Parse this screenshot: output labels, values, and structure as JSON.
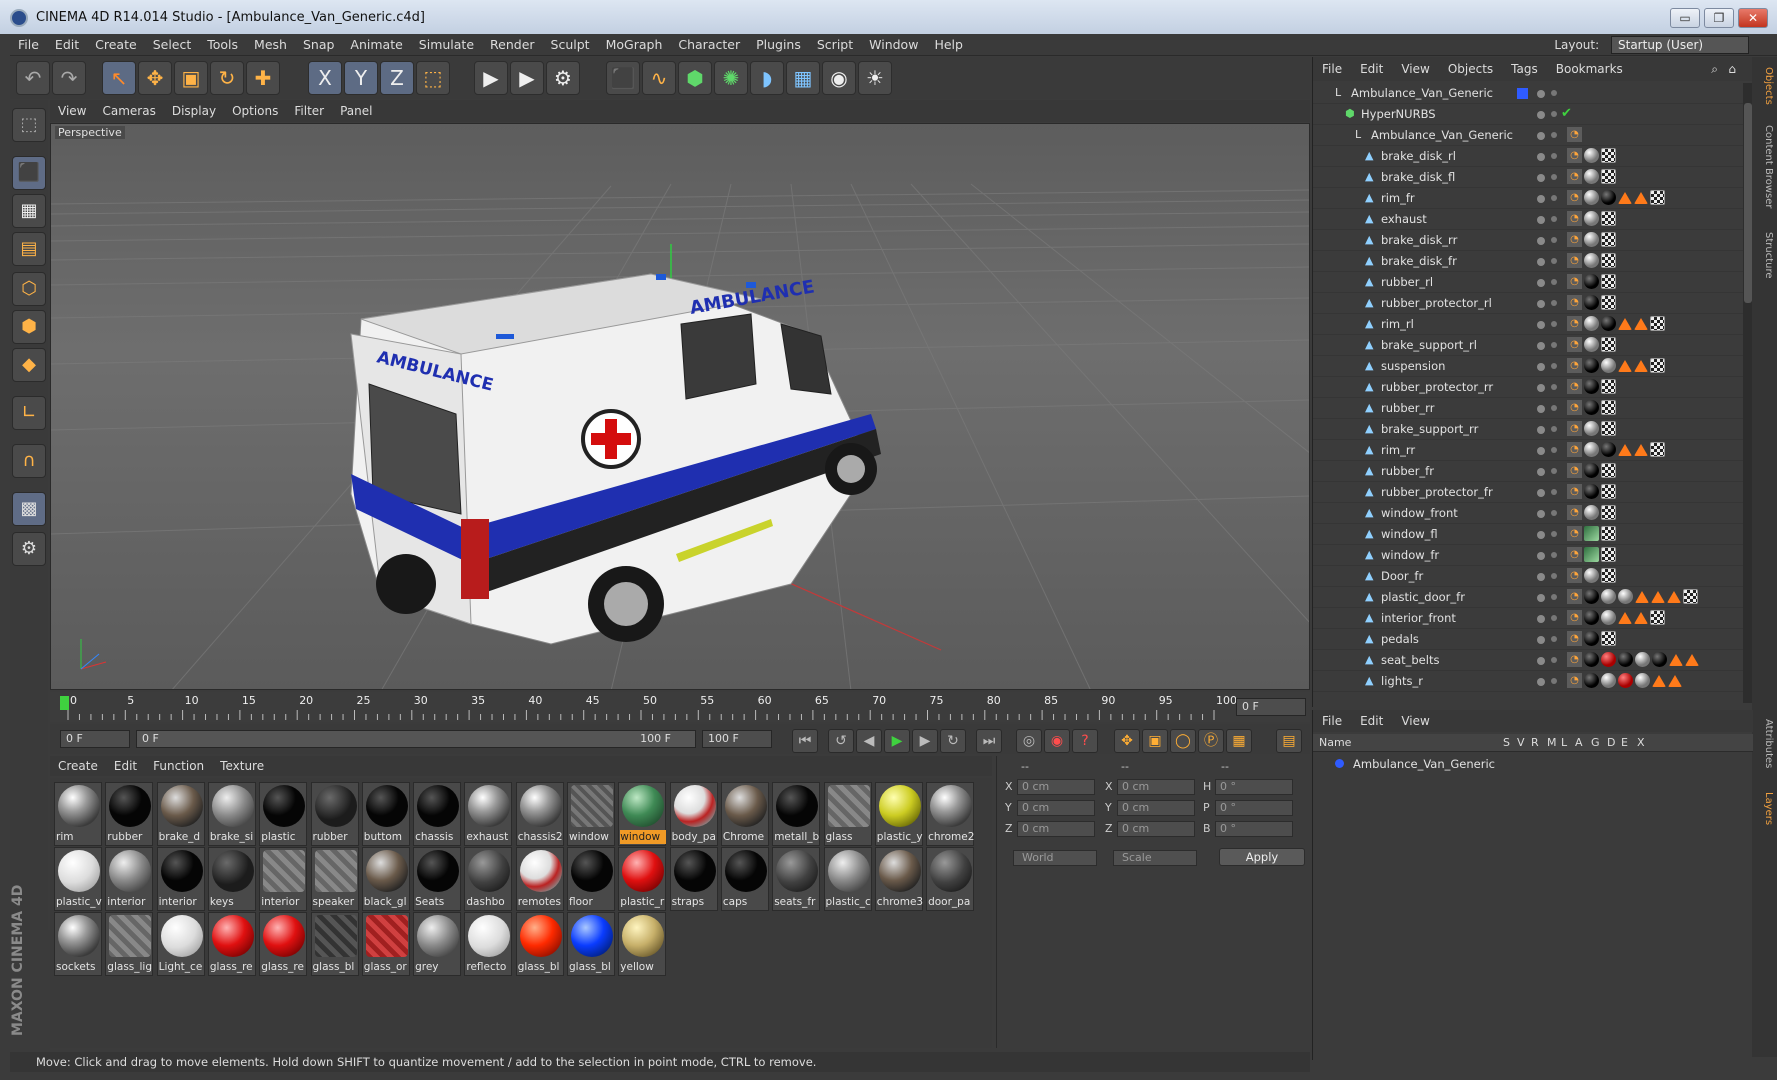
{
  "window": {
    "title": "CINEMA 4D R14.014 Studio - [Ambulance_Van_Generic.c4d]",
    "min": "▭",
    "max": "❐",
    "close": "✕"
  },
  "menu": [
    "File",
    "Edit",
    "Create",
    "Select",
    "Tools",
    "Mesh",
    "Snap",
    "Animate",
    "Simulate",
    "Render",
    "Sculpt",
    "MoGraph",
    "Character",
    "Plugins",
    "Script",
    "Window",
    "Help"
  ],
  "layout": {
    "label": "Layout:",
    "value": "Startup (User)"
  },
  "toolbar": {
    "undo": "↶",
    "redo": "↷",
    "select": "↖",
    "move": "✥",
    "scale": "▣",
    "rotate": "↻",
    "add": "✚",
    "x": "X",
    "y": "Y",
    "z": "Z",
    "coord": "⬚",
    "render_view": "▶",
    "render_pv": "▶",
    "render_settings": "⚙",
    "cube": "⬛",
    "spline": "∿",
    "nurbs": "⬢",
    "array": "✺",
    "deformer": "◗",
    "floor": "▦",
    "camera": "◉",
    "light": "☀"
  },
  "viewport": {
    "menu": [
      "View",
      "Cameras",
      "Display",
      "Options",
      "Filter",
      "Panel"
    ],
    "label": "Perspective",
    "vehicle_side_text": "AMBULANCE",
    "vehicle_rear_text": "AMBULANCE"
  },
  "timeline": {
    "ticks": [
      "0",
      "5",
      "10",
      "15",
      "20",
      "25",
      "30",
      "35",
      "40",
      "45",
      "50",
      "55",
      "60",
      "65",
      "70",
      "75",
      "80",
      "85",
      "90",
      "95",
      "100"
    ],
    "frame_display": "0 F"
  },
  "playback": {
    "start": "0 F",
    "range_start": "0 F",
    "range_end": "100 F",
    "end": "100 F"
  },
  "materials": {
    "menu": [
      "Create",
      "Edit",
      "Function",
      "Texture"
    ],
    "items": [
      {
        "label": "rim",
        "style": "chrome"
      },
      {
        "label": "rubber",
        "style": "black"
      },
      {
        "label": "brake_d",
        "style": "env"
      },
      {
        "label": "brake_si",
        "style": "grey"
      },
      {
        "label": "plastic",
        "style": "black"
      },
      {
        "label": "rubber",
        "style": "darkgrain"
      },
      {
        "label": "buttom",
        "style": "black"
      },
      {
        "label": "chassis",
        "style": "black"
      },
      {
        "label": "exhaust",
        "style": "chrome"
      },
      {
        "label": "chassis2",
        "style": "chrome"
      },
      {
        "label": "window",
        "style": "tex"
      },
      {
        "label": "window",
        "style": "green",
        "selected": true
      },
      {
        "label": "body_pa",
        "style": "body"
      },
      {
        "label": "Chrome",
        "style": "env"
      },
      {
        "label": "metall_b",
        "style": "black"
      },
      {
        "label": "glass",
        "style": "glass"
      },
      {
        "label": "plastic_y",
        "style": "yellow"
      },
      {
        "label": "chrome2",
        "style": "chrome"
      },
      {
        "label": "plastic_v",
        "style": "white"
      },
      {
        "label": "interior",
        "style": "grey"
      },
      {
        "label": "interior",
        "style": "black"
      },
      {
        "label": "keys",
        "style": "darkgrain"
      },
      {
        "label": "interior",
        "style": "glass"
      },
      {
        "label": "speaker",
        "style": "glass"
      },
      {
        "label": "black_gl",
        "style": "env"
      },
      {
        "label": "Seats",
        "style": "black"
      },
      {
        "label": "dashbo",
        "style": "darkgrey"
      },
      {
        "label": "remotes",
        "style": "body"
      },
      {
        "label": "floor",
        "style": "black"
      },
      {
        "label": "plastic_r",
        "style": "red"
      },
      {
        "label": "straps",
        "style": "black"
      },
      {
        "label": "caps",
        "style": "black"
      },
      {
        "label": "seats_fr",
        "style": "darkgrey"
      },
      {
        "label": "plastic_c",
        "style": "grey"
      },
      {
        "label": "chrome3",
        "style": "env"
      },
      {
        "label": "door_pa",
        "style": "darkgrey"
      },
      {
        "label": "sockets",
        "style": "chrome"
      },
      {
        "label": "glass_lig",
        "style": "glass"
      },
      {
        "label": "Light_ce",
        "style": "white"
      },
      {
        "label": "glass_re",
        "style": "red"
      },
      {
        "label": "glass_re",
        "style": "red"
      },
      {
        "label": "glass_bl",
        "style": "glassdark"
      },
      {
        "label": "glass_or",
        "style": "glassred"
      },
      {
        "label": "grey",
        "style": "grey"
      },
      {
        "label": "reflecto",
        "style": "white"
      },
      {
        "label": "glass_bl",
        "style": "redorange"
      },
      {
        "label": "glass_bl",
        "style": "blue"
      },
      {
        "label": "yellow",
        "style": "gold"
      }
    ]
  },
  "coords": {
    "header": [
      "--",
      "--",
      "--"
    ],
    "rows": [
      {
        "a": "X",
        "av": "0 cm",
        "b": "X",
        "bv": "0 cm",
        "c": "H",
        "cv": "0 °"
      },
      {
        "a": "Y",
        "av": "0 cm",
        "b": "Y",
        "bv": "0 cm",
        "c": "P",
        "cv": "0 °"
      },
      {
        "a": "Z",
        "av": "0 cm",
        "b": "Z",
        "bv": "0 cm",
        "c": "B",
        "cv": "0 °"
      }
    ],
    "world": "World",
    "scale": "Scale",
    "apply": "Apply"
  },
  "status": "Move: Click and drag to move elements. Hold down SHIFT to quantize movement / add to the selection in point mode, CTRL to remove.",
  "objects": {
    "menu": [
      "File",
      "Edit",
      "View",
      "Objects",
      "Tags",
      "Bookmarks"
    ],
    "rows": [
      {
        "name": "Ambulance_Van_Generic",
        "indent": 0,
        "icon": "null",
        "tags": []
      },
      {
        "name": "HyperNURBS",
        "indent": 1,
        "icon": "nurbs",
        "tags": []
      },
      {
        "name": "Ambulance_Van_Generic",
        "indent": 2,
        "icon": "null",
        "tags": [
          "phong"
        ]
      },
      {
        "name": "brake_disk_rl",
        "indent": 3,
        "icon": "poly",
        "tags": [
          "phong",
          "gry",
          "chk"
        ]
      },
      {
        "name": "brake_disk_fl",
        "indent": 3,
        "icon": "poly",
        "tags": [
          "phong",
          "gry",
          "chk"
        ]
      },
      {
        "name": "rim_fr",
        "indent": 3,
        "icon": "poly",
        "tags": [
          "phong",
          "gry",
          "blk",
          "tri",
          "tri",
          "chk"
        ]
      },
      {
        "name": "exhaust",
        "indent": 3,
        "icon": "poly",
        "tags": [
          "phong",
          "gry",
          "chk"
        ]
      },
      {
        "name": "brake_disk_rr",
        "indent": 3,
        "icon": "poly",
        "tags": [
          "phong",
          "gry",
          "chk"
        ]
      },
      {
        "name": "brake_disk_fr",
        "indent": 3,
        "icon": "poly",
        "tags": [
          "phong",
          "gry",
          "chk"
        ]
      },
      {
        "name": "rubber_rl",
        "indent": 3,
        "icon": "poly",
        "tags": [
          "phong",
          "blk",
          "chk"
        ]
      },
      {
        "name": "rubber_protector_rl",
        "indent": 3,
        "icon": "poly",
        "tags": [
          "phong",
          "blk",
          "chk"
        ]
      },
      {
        "name": "rim_rl",
        "indent": 3,
        "icon": "poly",
        "tags": [
          "phong",
          "gry",
          "blk",
          "tri",
          "tri",
          "chk"
        ]
      },
      {
        "name": "brake_support_rl",
        "indent": 3,
        "icon": "poly",
        "tags": [
          "phong",
          "gry",
          "chk"
        ]
      },
      {
        "name": "suspension",
        "indent": 3,
        "icon": "poly",
        "tags": [
          "phong",
          "blk",
          "gry",
          "tri",
          "tri",
          "chk"
        ]
      },
      {
        "name": "rubber_protector_rr",
        "indent": 3,
        "icon": "poly",
        "tags": [
          "phong",
          "blk",
          "chk"
        ]
      },
      {
        "name": "rubber_rr",
        "indent": 3,
        "icon": "poly",
        "tags": [
          "phong",
          "blk",
          "chk"
        ]
      },
      {
        "name": "brake_support_rr",
        "indent": 3,
        "icon": "poly",
        "tags": [
          "phong",
          "gry",
          "chk"
        ]
      },
      {
        "name": "rim_rr",
        "indent": 3,
        "icon": "poly",
        "tags": [
          "phong",
          "gry",
          "blk",
          "tri",
          "tri",
          "chk"
        ]
      },
      {
        "name": "rubber_fr",
        "indent": 3,
        "icon": "poly",
        "tags": [
          "phong",
          "blk",
          "chk"
        ]
      },
      {
        "name": "rubber_protector_fr",
        "indent": 3,
        "icon": "poly",
        "tags": [
          "phong",
          "blk",
          "chk"
        ]
      },
      {
        "name": "window_front",
        "indent": 3,
        "icon": "poly",
        "tags": [
          "phong",
          "gry",
          "chk"
        ]
      },
      {
        "name": "window_fl",
        "indent": 3,
        "icon": "poly",
        "tags": [
          "phong",
          "grn",
          "chk"
        ]
      },
      {
        "name": "window_fr",
        "indent": 3,
        "icon": "poly",
        "tags": [
          "phong",
          "grn",
          "chk"
        ]
      },
      {
        "name": "Door_fr",
        "indent": 3,
        "icon": "poly",
        "tags": [
          "phong",
          "gry",
          "chk"
        ]
      },
      {
        "name": "plastic_door_fr",
        "indent": 3,
        "icon": "poly",
        "tags": [
          "phong",
          "blk",
          "gry",
          "gry",
          "tri",
          "tri",
          "tri",
          "chk"
        ]
      },
      {
        "name": "interior_front",
        "indent": 3,
        "icon": "poly",
        "tags": [
          "phong",
          "blk",
          "gry",
          "tri",
          "tri",
          "chk"
        ]
      },
      {
        "name": "pedals",
        "indent": 3,
        "icon": "poly",
        "tags": [
          "phong",
          "blk",
          "chk"
        ]
      },
      {
        "name": "seat_belts",
        "indent": 3,
        "icon": "poly",
        "tags": [
          "phong",
          "blk",
          "red",
          "blk",
          "gry",
          "blk",
          "tri",
          "tri"
        ]
      },
      {
        "name": "lights_r",
        "indent": 3,
        "icon": "poly",
        "tags": [
          "phong",
          "blk",
          "gry",
          "red",
          "gry",
          "tri",
          "tri"
        ]
      }
    ]
  },
  "side_tabs": [
    "Objects",
    "Content Browser",
    "Structure",
    "Attributes",
    "Layers"
  ],
  "attributes": {
    "menu": [
      "File",
      "Edit",
      "View"
    ],
    "columns": [
      "Name",
      "S",
      "V",
      "R",
      "M",
      "L",
      "A",
      "G",
      "D",
      "E",
      "X"
    ],
    "row": "Ambulance_Van_Generic"
  },
  "colors": {
    "accent": "#f09a26",
    "selection": "#5d6b84",
    "background": "#3b3b3b"
  }
}
